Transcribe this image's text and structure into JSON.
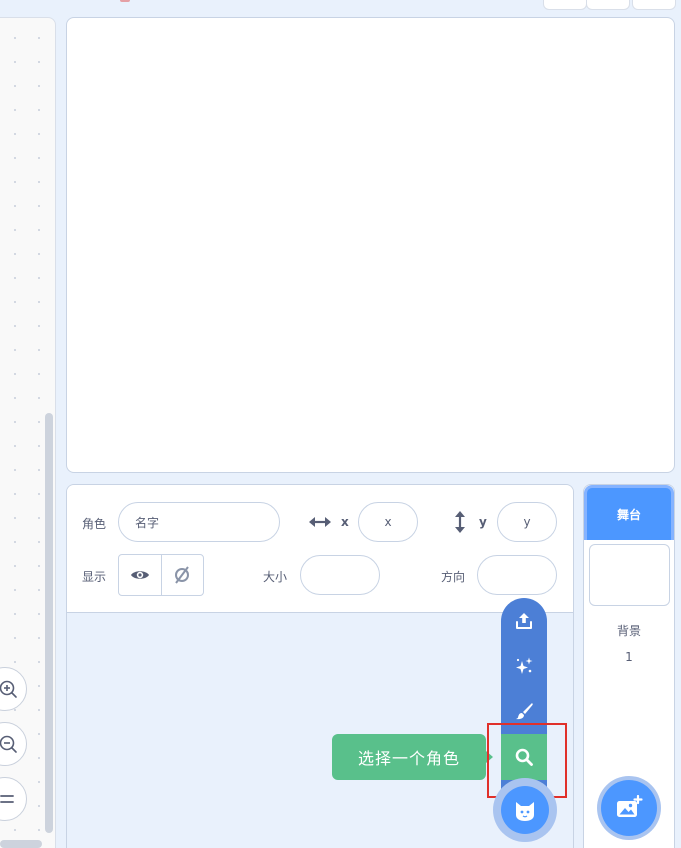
{
  "sprite_info": {
    "sprite_label": "角色",
    "name_placeholder": "名字",
    "x_label": "x",
    "x_placeholder": "x",
    "y_label": "y",
    "y_placeholder": "y",
    "show_label": "显示",
    "size_label": "大小",
    "direction_label": "方向"
  },
  "add_sprite_menu": {
    "items": [
      {
        "name": "upload",
        "icon": "upload-icon"
      },
      {
        "name": "surprise",
        "icon": "sparkle-icon"
      },
      {
        "name": "paint",
        "icon": "paintbrush-icon"
      },
      {
        "name": "choose",
        "icon": "search-icon",
        "active": true
      }
    ],
    "tooltip": "选择一个角色"
  },
  "stage_pane": {
    "header": "舞台",
    "backdrops_label": "背景",
    "backdrop_count": "1"
  },
  "colors": {
    "accent": "#4c97ff",
    "menu_blue": "#4c7fd6",
    "active_green": "#59c08b",
    "highlight_red": "#e0302a"
  }
}
